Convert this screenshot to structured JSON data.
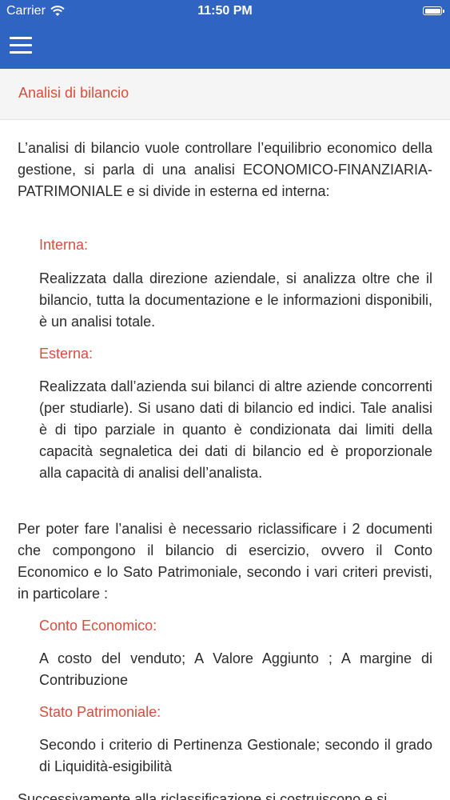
{
  "status_bar": {
    "carrier": "Carrier",
    "time": "11:50 PM"
  },
  "header": {
    "title": "Analisi di bilancio"
  },
  "content": {
    "intro": "L’analisi di bilancio vuole controllare l’equilibrio economico della gestione, si parla di una analisi ECONOMICO-FINANZIARIA-PATRIMONIALE e si divide in esterna ed interna:",
    "interna_title": "Interna:",
    "interna_text": "Realizzata dalla direzione aziendale, si analizza oltre che il bilancio, tutta la documentazione e le informazioni disponibili, è un analisi totale.",
    "esterna_title": "Esterna:",
    "esterna_text": "Realizzata dall’azienda sui bilanci di altre aziende concorrenti (per studiarle). Si usano dati di bilancio ed indici. Tale analisi è di tipo parziale in quanto è condizionata dai limiti della capacità segnaletica dei dati di bilancio ed è proporzionale alla capacità di analisi dell’analista.",
    "riclass": "Per poter fare l’analisi è necessario riclassificare i 2 documenti che compongono il bilancio di esercizio, ovvero il Conto Economico e lo Sato Patrimoniale, secondo i vari criteri previsti, in particolare :",
    "ce_title": "Conto Economico:",
    "ce_text": "A costo del venduto; A Valore Aggiunto ; A margine di Contribuzione",
    "sp_title": "Stato Patrimoniale:",
    "sp_text": "Secondo i criterio di Pertinenza Gestionale; secondo il grado di Liquidità-esigibilità",
    "next": "Successivamente alla riclassificazione si costruiscono e si"
  }
}
